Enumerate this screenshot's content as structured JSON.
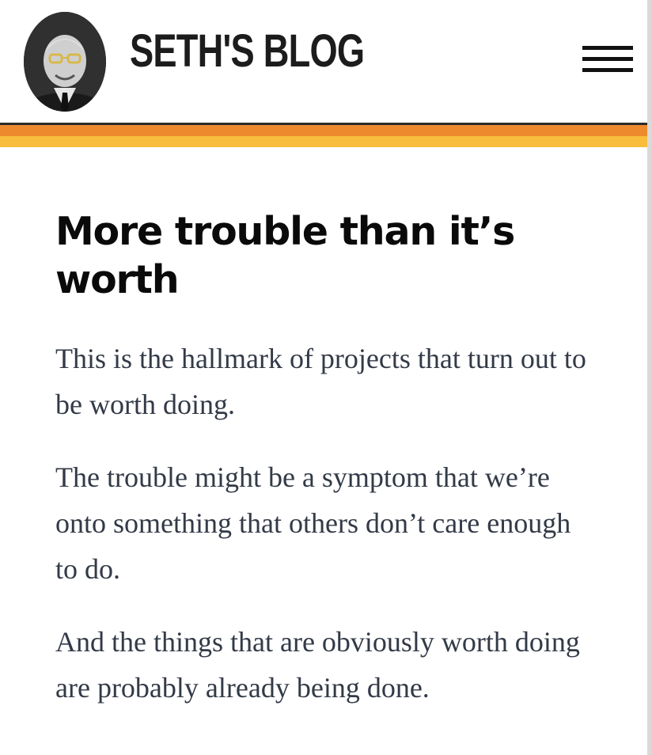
{
  "header": {
    "site_title": "SETH'S BLOG",
    "menu_icon": "hamburger-menu-icon",
    "avatar": "author-photo"
  },
  "stripes": {
    "colors": [
      "#2a2a2a",
      "#ee8a2e",
      "#f8bd3c"
    ]
  },
  "post": {
    "title": "More trouble than it’s worth",
    "paragraphs": [
      "This is the hallmark of projects that turn out to be worth doing.",
      "The trouble might be a symptom that we’re onto something that others don’t care enough to do.",
      "And the things that are obviously worth doing are probably already being done."
    ]
  }
}
